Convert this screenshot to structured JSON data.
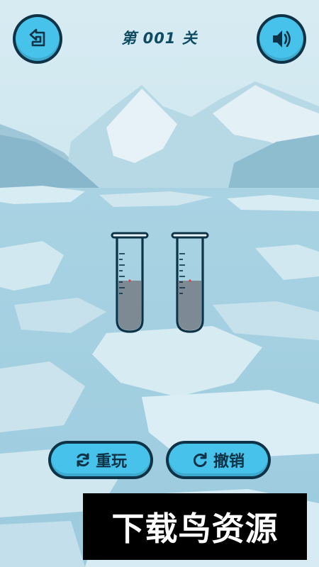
{
  "header": {
    "level_title": "第 001 关",
    "back_icon": "back-arrow-icon",
    "sound_icon": "speaker-icon"
  },
  "tubes": [
    {
      "fill_fraction": 0.5,
      "liquid_color": "#7d8a93"
    },
    {
      "fill_fraction": 0.5,
      "liquid_color": "#7d8a93"
    }
  ],
  "controls": {
    "restart_label": "重玩",
    "restart_icon": "refresh-icon",
    "undo_label": "撤销",
    "undo_icon": "undo-icon"
  },
  "watermark": {
    "text": "下载鸟资源"
  },
  "colors": {
    "button_fill": "#47c2ea",
    "button_border": "#0e3246",
    "title_color": "#0e4b63"
  }
}
